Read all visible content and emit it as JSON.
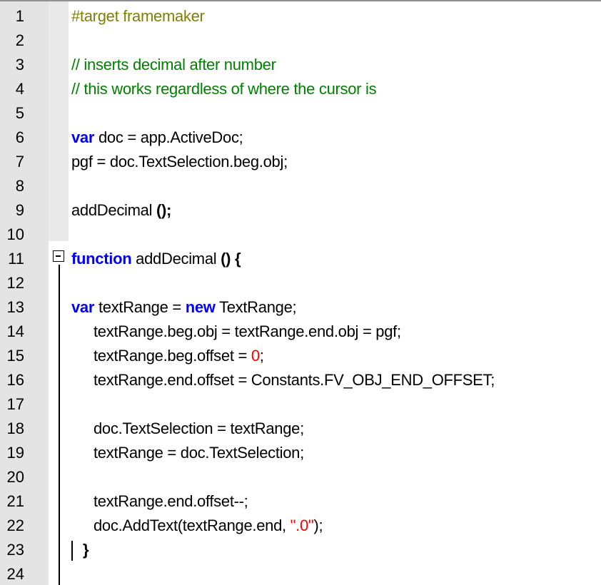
{
  "editor": {
    "lines": [
      {
        "n": "1",
        "text": "#target framemaker"
      },
      {
        "n": "2",
        "text": ""
      },
      {
        "n": "3",
        "text": "// inserts decimal after number"
      },
      {
        "n": "4",
        "text": "// this works regardless of where the cursor is"
      },
      {
        "n": "5",
        "text": ""
      },
      {
        "n": "6",
        "kw": "var",
        "rest": " doc = app.ActiveDoc;"
      },
      {
        "n": "7",
        "text": "pgf = doc.TextSelection.beg.obj;"
      },
      {
        "n": "8",
        "text": ""
      },
      {
        "n": "9",
        "a": "addDecimal ",
        "op": "();"
      },
      {
        "n": "10",
        "text": ""
      },
      {
        "n": "11",
        "kw": "function",
        "a": " addDecimal ",
        "op": "() {"
      },
      {
        "n": "12",
        "text": ""
      },
      {
        "n": "13",
        "kw": "var",
        "a": " textRange = ",
        "kw2": "new",
        "b": " TextRange;"
      },
      {
        "n": "14",
        "text": "textRange.beg.obj = textRange.end.obj = pgf;"
      },
      {
        "n": "15",
        "a": "textRange.beg.offset = ",
        "num": "0",
        "b": ";"
      },
      {
        "n": "16",
        "text": "textRange.end.offset = Constants.FV_OBJ_END_OFFSET;"
      },
      {
        "n": "17",
        "text": ""
      },
      {
        "n": "18",
        "text": "doc.TextSelection = textRange;"
      },
      {
        "n": "19",
        "text": "textRange = doc.TextSelection;"
      },
      {
        "n": "20",
        "text": ""
      },
      {
        "n": "21",
        "text": "textRange.end.offset--;"
      },
      {
        "n": "22",
        "a": "doc.AddText(textRange.end, ",
        "str": "\".0\"",
        "b": ");"
      },
      {
        "n": "23",
        "text": "}"
      },
      {
        "n": "24",
        "text": ""
      }
    ]
  },
  "colors": {
    "keyword": "#0000ff",
    "comment": "#008000",
    "preprocessor": "#808000",
    "number": "#ff0000",
    "gutter": "#e4e4e4"
  },
  "icons": {
    "fold": "fold-minus-icon"
  }
}
